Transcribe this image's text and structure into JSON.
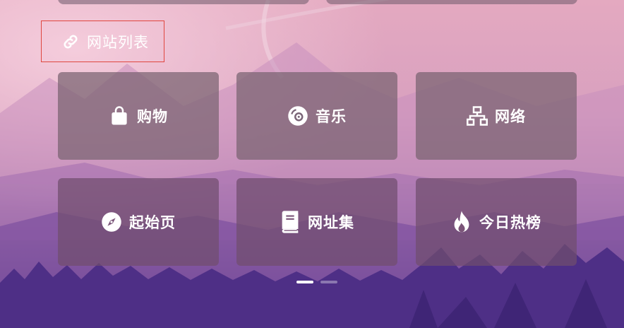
{
  "section": {
    "title": "网站列表",
    "icon": "link-icon"
  },
  "tiles": [
    {
      "label": "购物",
      "icon": "shopping-bag-icon"
    },
    {
      "label": "音乐",
      "icon": "music-disc-icon"
    },
    {
      "label": "网络",
      "icon": "network-icon"
    },
    {
      "label": "起始页",
      "icon": "compass-icon"
    },
    {
      "label": "网址集",
      "icon": "book-icon"
    },
    {
      "label": "今日热榜",
      "icon": "fire-icon"
    }
  ],
  "pagination": {
    "pages": 2,
    "current": 1
  },
  "colors": {
    "header_border": "#e0463f"
  }
}
